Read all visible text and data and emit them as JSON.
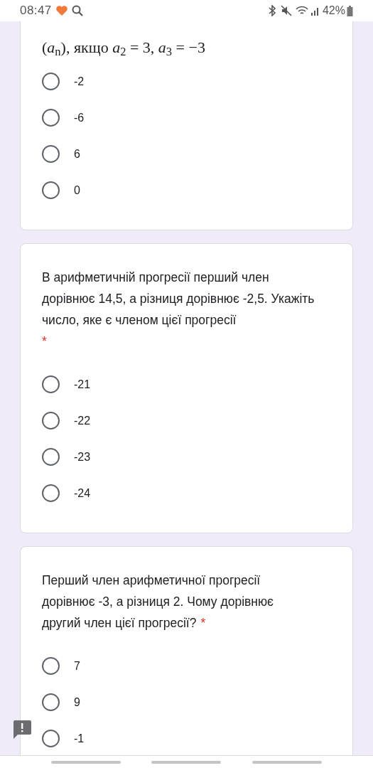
{
  "status_bar": {
    "time": "08:47",
    "battery": "42%"
  },
  "questions": [
    {
      "text": "(*a*$_{n}$), якщо *a*$_{2}$ = 3, *a*$_{3}$ = −3",
      "kind": "formula",
      "required": false,
      "options": [
        {
          "label": "-2",
          "selected": false
        },
        {
          "label": "-6",
          "selected": false
        },
        {
          "label": "6",
          "selected": false
        },
        {
          "label": "0",
          "selected": false
        }
      ]
    },
    {
      "text": "В арифметичній прогресії перший член дорівнює 14,5, а різниця дорівнює -2,5. Укажіть число, яке є членом цієї прогресії",
      "kind": "text",
      "required": true,
      "required_mark": "*",
      "options": [
        {
          "label": "-21",
          "selected": false
        },
        {
          "label": "-22",
          "selected": false
        },
        {
          "label": "-23",
          "selected": false
        },
        {
          "label": "-24",
          "selected": false
        }
      ]
    },
    {
      "text": "Перший член арифметичної прогресії дорівнює -3, а різниця 2. Чому дорівнює другий член цієї прогресії?",
      "kind": "text",
      "required": true,
      "required_mark": "*",
      "options": [
        {
          "label": "7",
          "selected": false
        },
        {
          "label": "9",
          "selected": false
        },
        {
          "label": "-1",
          "selected": false
        }
      ]
    }
  ]
}
